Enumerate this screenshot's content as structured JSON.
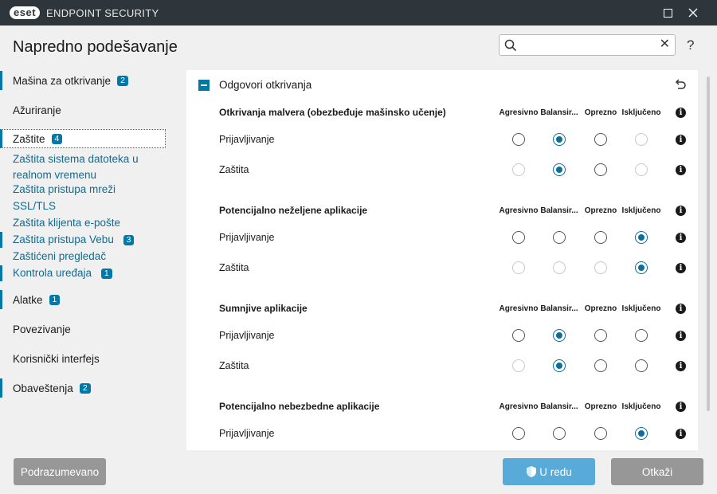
{
  "app": {
    "logo_text": "eset",
    "product_name": "ENDPOINT SECURITY"
  },
  "header": {
    "title": "Napredno podešavanje",
    "search": {
      "value": "",
      "placeholder": ""
    },
    "help_label": "?"
  },
  "sidebar": {
    "items": [
      {
        "label": "Mašina za otkrivanje",
        "badge": "2"
      },
      {
        "label": "Ažuriranje"
      },
      {
        "label": "Zaštite",
        "badge": "4"
      },
      {
        "label": "Alatke",
        "badge": "1"
      },
      {
        "label": "Povezivanje"
      },
      {
        "label": "Korisnički interfejs"
      },
      {
        "label": "Obaveštenja",
        "badge": "2"
      }
    ],
    "subitems": [
      {
        "label": "Zaštita sistema datoteka u realnom vremenu"
      },
      {
        "label": "Zaštita pristupa mreži"
      },
      {
        "label": "SSL/TLS"
      },
      {
        "label": "Zaštita klijenta e-pošte"
      },
      {
        "label": "Zaštita pristupa Vebu",
        "badge": "3"
      },
      {
        "label": "Zaštićeni pregledač"
      },
      {
        "label": "Kontrola uređaja",
        "badge": "1"
      }
    ]
  },
  "panel": {
    "section_title": "Odgovori otkrivanja",
    "columns": [
      "Agresivno",
      "Balansir...",
      "Oprezno",
      "Isključeno"
    ],
    "groups": [
      {
        "title": "Otkrivanja malvera (obezbeđuje mašinsko učenje)",
        "rows": [
          {
            "label": "Prijavljivanje",
            "selected": 1,
            "disabled": [
              3
            ]
          },
          {
            "label": "Zaštita",
            "selected": 1,
            "disabled": [
              0,
              3
            ]
          }
        ]
      },
      {
        "title": "Potencijalno neželjene aplikacije",
        "rows": [
          {
            "label": "Prijavljivanje",
            "selected": 3,
            "disabled": []
          },
          {
            "label": "Zaštita",
            "selected": 3,
            "disabled": [
              0,
              1,
              2
            ]
          }
        ]
      },
      {
        "title": "Sumnjive aplikacije",
        "rows": [
          {
            "label": "Prijavljivanje",
            "selected": 1,
            "disabled": []
          },
          {
            "label": "Zaštita",
            "selected": 1,
            "disabled": [
              0
            ]
          }
        ]
      },
      {
        "title": "Potencijalno nebezbedne aplikacije",
        "rows": [
          {
            "label": "Prijavljivanje",
            "selected": 3,
            "disabled": []
          }
        ]
      }
    ]
  },
  "footer": {
    "default_label": "Podrazumevano",
    "ok_label": "U redu",
    "cancel_label": "Otkaži"
  },
  "colors": {
    "titlebar": "#2e363b",
    "accent": "#0079a8",
    "ok_button": "#58abd8",
    "gray_button": "#979797"
  }
}
